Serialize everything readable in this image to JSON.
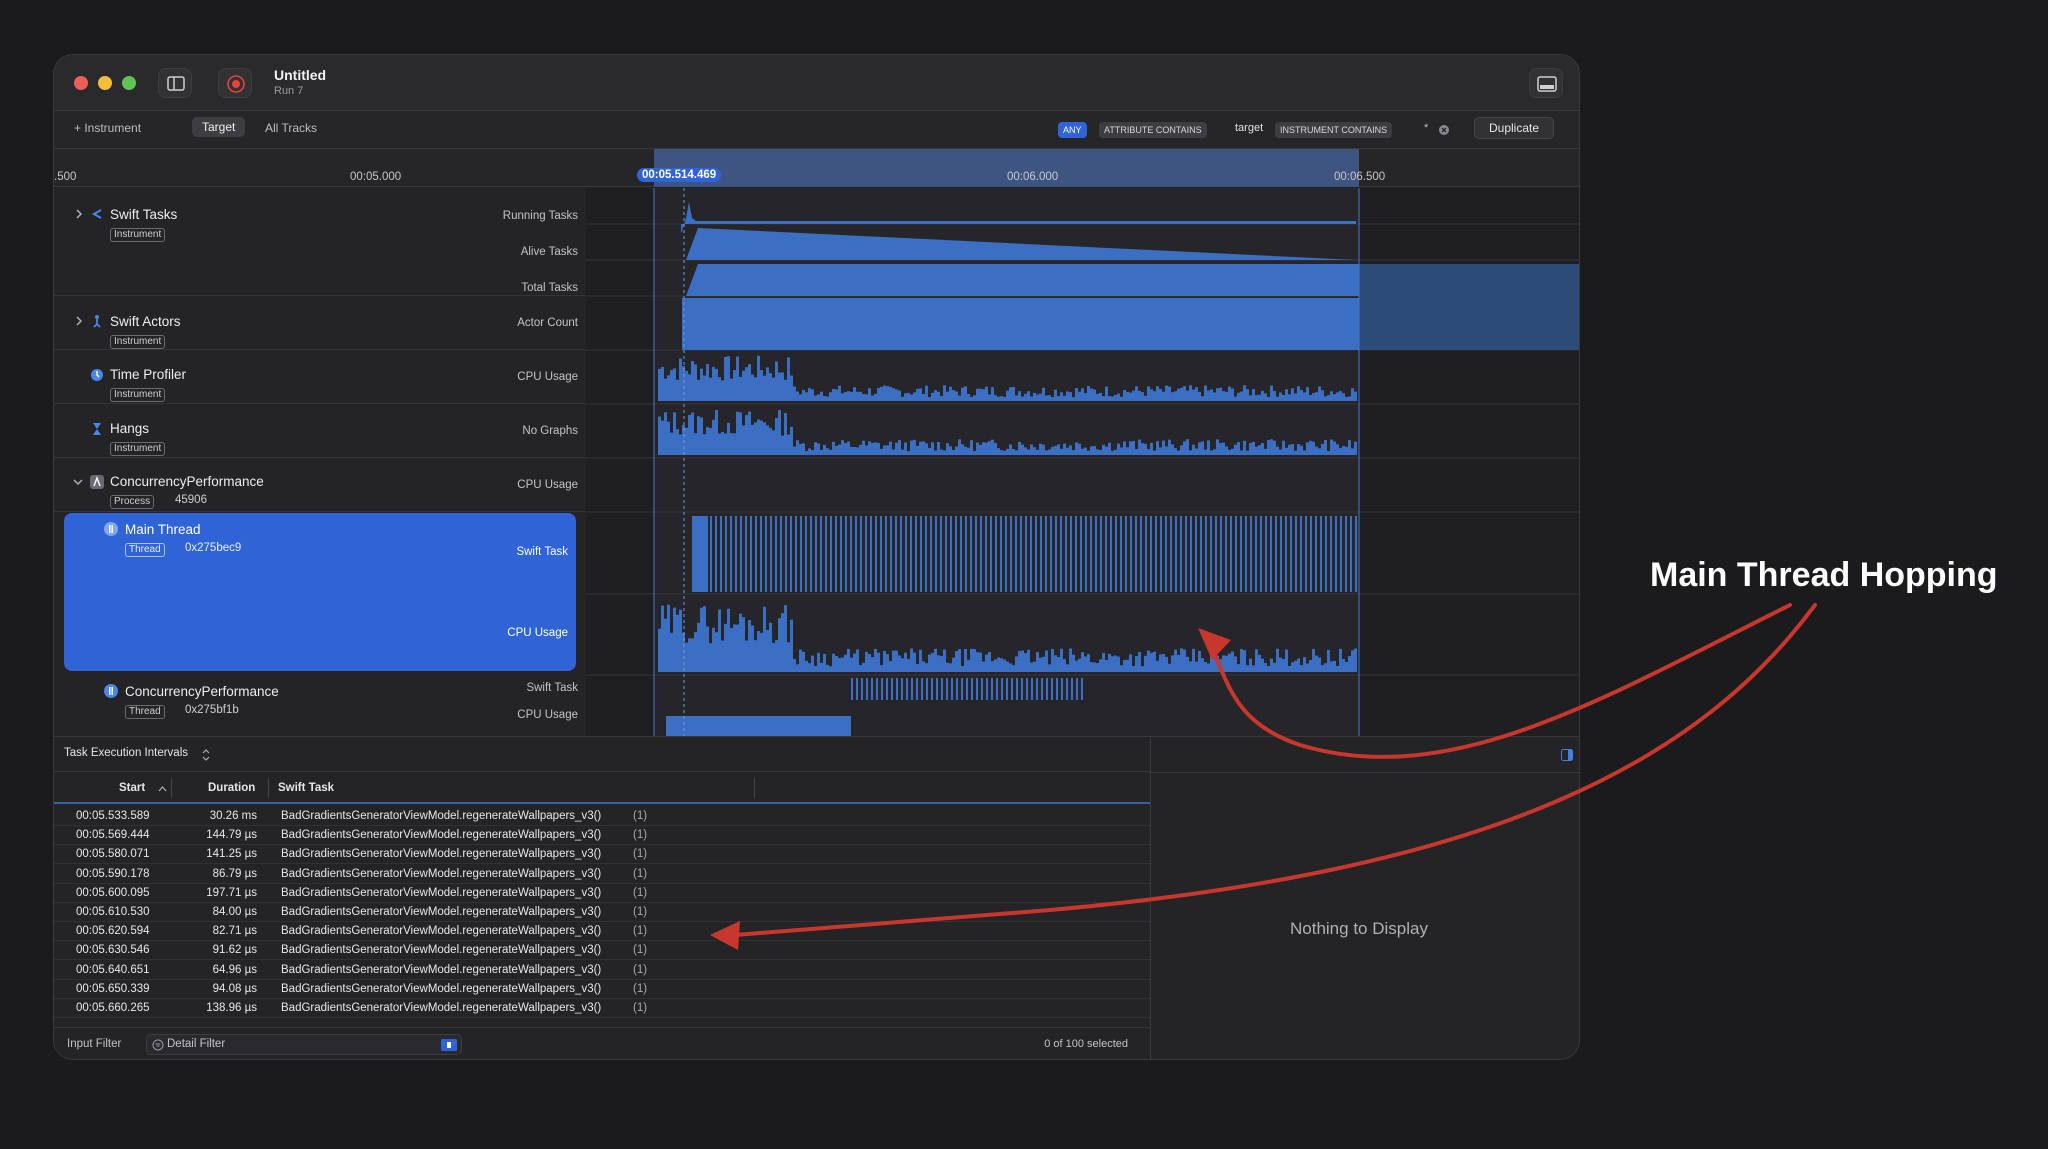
{
  "window": {
    "title": "Untitled",
    "subtitle": "Run 7"
  },
  "toolbar": {
    "add_instrument": "+ Instrument",
    "tab_target": "Target",
    "tab_all_tracks": "All Tracks",
    "filter_any": "ANY",
    "filter_attr": "ATTRIBUTE CONTAINS",
    "filter_value": "target",
    "filter_instr": "INSTRUMENT CONTAINS",
    "filter_star": "*",
    "duplicate": "Duplicate"
  },
  "ruler": {
    "t0": ".500",
    "t1": "00:05.000",
    "cursor": "00:05.514.469",
    "t2": "00:06.000",
    "t3": "00:06.500"
  },
  "tracks": {
    "swift_tasks": {
      "name": "Swift Tasks",
      "badge": "Instrument",
      "l1": "Running Tasks",
      "l2": "Alive Tasks",
      "l3": "Total Tasks"
    },
    "swift_actors": {
      "name": "Swift Actors",
      "badge": "Instrument",
      "l1": "Actor Count"
    },
    "time_profiler": {
      "name": "Time Profiler",
      "badge": "Instrument",
      "l1": "CPU Usage"
    },
    "hangs": {
      "name": "Hangs",
      "badge": "Instrument",
      "l1": "No Graphs"
    },
    "process": {
      "name": "ConcurrencyPerformance",
      "badge": "Process",
      "pid": "45906",
      "l1": "CPU Usage"
    },
    "main_thread": {
      "name": "Main Thread",
      "badge": "Thread",
      "tid": "0x275bec9",
      "l1": "Swift Task",
      "l2": "CPU Usage"
    },
    "thread2": {
      "name": "ConcurrencyPerformance",
      "badge": "Thread",
      "tid": "0x275bf1b",
      "l1": "Swift Task",
      "l2": "CPU Usage"
    }
  },
  "detail": {
    "selector": "Task Execution Intervals",
    "columns": {
      "start": "Start",
      "duration": "Duration",
      "task": "Swift Task"
    },
    "rows": [
      {
        "start": "00:05.533.589",
        "duration": "30.26 ms",
        "task": "BadGradientsGeneratorViewModel.regenerateWallpapers_v3()",
        "count": "(1)"
      },
      {
        "start": "00:05.569.444",
        "duration": "144.79 µs",
        "task": "BadGradientsGeneratorViewModel.regenerateWallpapers_v3()",
        "count": "(1)"
      },
      {
        "start": "00:05.580.071",
        "duration": "141.25 µs",
        "task": "BadGradientsGeneratorViewModel.regenerateWallpapers_v3()",
        "count": "(1)"
      },
      {
        "start": "00:05.590.178",
        "duration": "86.79 µs",
        "task": "BadGradientsGeneratorViewModel.regenerateWallpapers_v3()",
        "count": "(1)"
      },
      {
        "start": "00:05.600.095",
        "duration": "197.71 µs",
        "task": "BadGradientsGeneratorViewModel.regenerateWallpapers_v3()",
        "count": "(1)"
      },
      {
        "start": "00:05.610.530",
        "duration": "84.00 µs",
        "task": "BadGradientsGeneratorViewModel.regenerateWallpapers_v3()",
        "count": "(1)"
      },
      {
        "start": "00:05.620.594",
        "duration": "82.71 µs",
        "task": "BadGradientsGeneratorViewModel.regenerateWallpapers_v3()",
        "count": "(1)"
      },
      {
        "start": "00:05.630.546",
        "duration": "91.62 µs",
        "task": "BadGradientsGeneratorViewModel.regenerateWallpapers_v3()",
        "count": "(1)"
      },
      {
        "start": "00:05.640.651",
        "duration": "64.96 µs",
        "task": "BadGradientsGeneratorViewModel.regenerateWallpapers_v3()",
        "count": "(1)"
      },
      {
        "start": "00:05.650.339",
        "duration": "94.08 µs",
        "task": "BadGradientsGeneratorViewModel.regenerateWallpapers_v3()",
        "count": "(1)"
      },
      {
        "start": "00:05.660.265",
        "duration": "138.96 µs",
        "task": "BadGradientsGeneratorViewModel.regenerateWallpapers_v3()",
        "count": "(1)"
      }
    ],
    "empty_message": "Nothing to Display",
    "input_filter": "Input Filter",
    "detail_filter": "Detail Filter",
    "selection_status": "0 of 100 selected"
  },
  "annotation": {
    "text": "Main Thread Hopping"
  },
  "colors": {
    "accent": "#2f63d6",
    "graph": "#3a6fc4",
    "arrow": "#c8372d"
  }
}
